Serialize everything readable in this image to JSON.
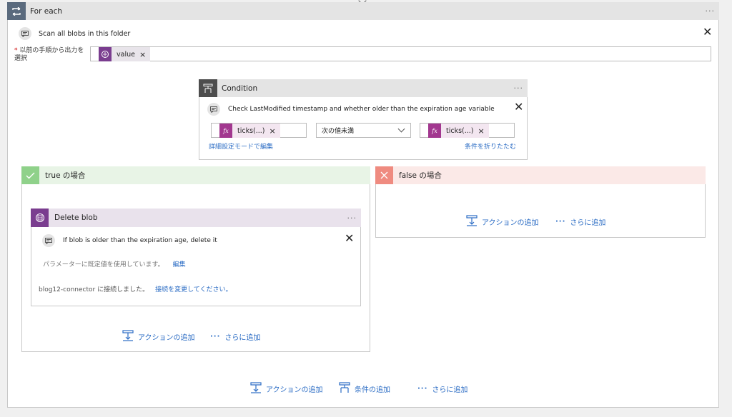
{
  "foreach": {
    "title": "For each",
    "more": "···",
    "comment": "Scan all blobs in this folder",
    "close": "✕",
    "input_required": "*",
    "input_label": "以前の手順から出力を選択",
    "token": "value",
    "token_x": "×"
  },
  "condition": {
    "title": "Condition",
    "more": "···",
    "comment": "Check LastModified timestamp and whether older than the expiration age variable",
    "close": "✕",
    "left_token": "ticks(...)",
    "right_token": "ticks(...)",
    "token_x": "×",
    "operator": "次の値未満",
    "fx": "fx",
    "advanced_link": "詳細設定モードで編集",
    "collapse_link": "条件を折りたたむ"
  },
  "true_branch": {
    "title": "true の場合",
    "add_action": "アクションの追加",
    "more_add": "さらに追加",
    "dots": "···"
  },
  "delete_blob": {
    "title": "Delete blob",
    "more": "···",
    "comment": "If blob is older than the expiration age, delete it",
    "close": "✕",
    "default_text": "パラメーターに既定値を使用しています。",
    "edit_link": "編集",
    "connection_text": "blog12-connector に接続しました。",
    "change_link": "接続を変更してください。"
  },
  "false_branch": {
    "title": "false の場合",
    "add_action": "アクションの追加",
    "more_add": "さらに追加",
    "dots": "···"
  },
  "footer": {
    "add_action": "アクションの追加",
    "add_condition": "条件の追加",
    "more_add": "さらに追加",
    "dots": "···"
  },
  "colors": {
    "header_gray": "#e4e4e4",
    "loop_icon_bg": "#5a6a7d",
    "condition_icon_bg": "#4d4d4d",
    "true_green": "#8fd18a",
    "true_bg": "#e8f4e6",
    "false_red": "#ef8b80",
    "false_bg": "#fbe9e7",
    "blob_purple": "#7a3d8f",
    "blob_bg": "#e9e2ec",
    "fx_purple": "#a2378f",
    "link_blue": "#2b6cc4"
  }
}
